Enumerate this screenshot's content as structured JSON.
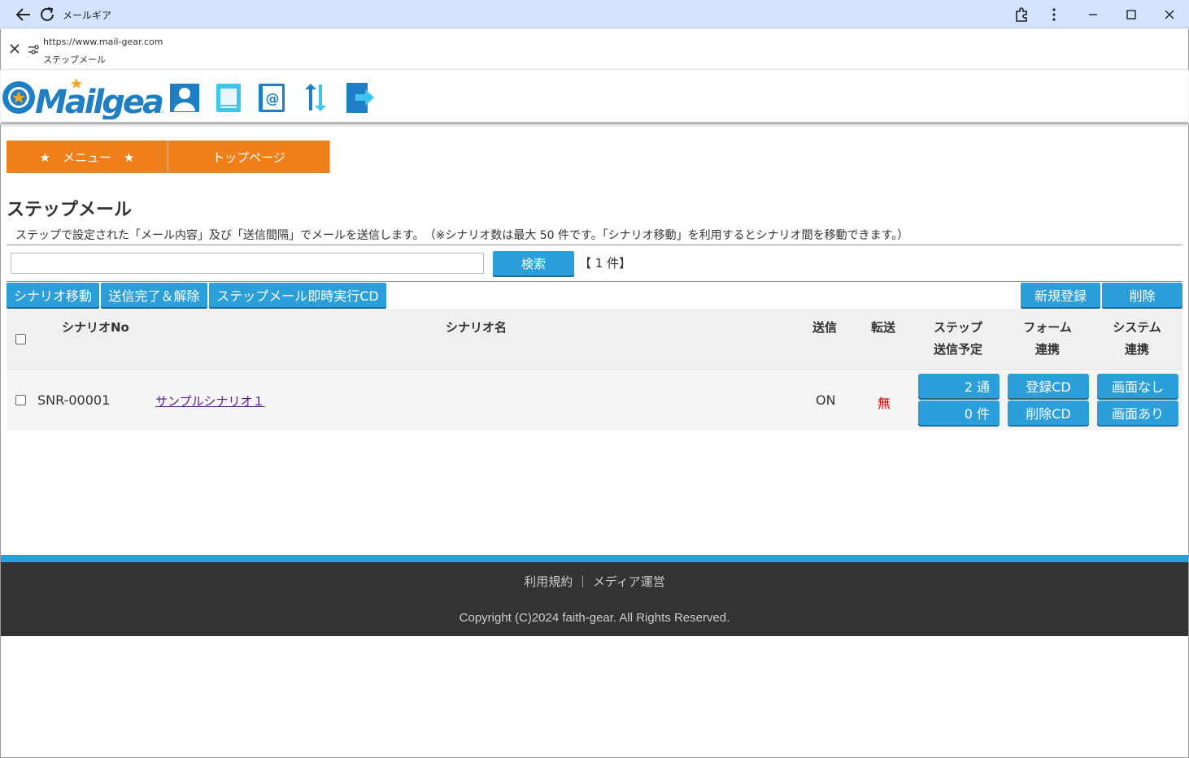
{
  "browser": {
    "window_title": "メールギア",
    "url": "https://www.mail-gear.com",
    "page_name": "ステップメール"
  },
  "header": {
    "logo_text": "Mailgear",
    "icons": [
      "user-icon",
      "document-icon",
      "address-book-icon",
      "sync-icon",
      "logout-icon"
    ]
  },
  "nav": {
    "menu_label": "★　メニュー　★",
    "top_label": "トップページ"
  },
  "page": {
    "title": "ステップメール",
    "description": "ステップで設定された「メール内容」及び「送信間隔」でメールを送信します。　（※シナリオ数は最大 50 件です。「シナリオ移動」を利用するとシナリオ間を移動できます。）"
  },
  "search": {
    "value": "",
    "placeholder": "",
    "button_label": "検索",
    "count_text": "【 1 件】"
  },
  "actions": {
    "move_label": "シナリオ移動",
    "complete_label": "送信完了＆解除",
    "instant_label": "ステップメール即時実行CD",
    "new_label": "新規登録",
    "delete_label": "削除"
  },
  "table": {
    "headers": {
      "no": "シナリオNo",
      "name": "シナリオ名",
      "send": "送信",
      "forward": "転送",
      "step_l1": "ステップ",
      "step_l2": "送信予定",
      "form_l1": "フォーム",
      "form_l2": "連携",
      "system_l1": "システム",
      "system_l2": "連携"
    },
    "rows": [
      {
        "no": "SNR-00001",
        "name": "サンプルシナリオ１",
        "send": "ON",
        "forward": "無",
        "steps": "2 通",
        "scheduled": "0 件",
        "form_register": "登録CD",
        "form_delete": "削除CD",
        "system_none": "画面なし",
        "system_with": "画面あり"
      }
    ]
  },
  "footer": {
    "terms": "利用規約",
    "separator": "｜",
    "media": "メディア運営",
    "copyright": "Copyright (C)2024 faith-gear. All Rights Reserved."
  },
  "colors": {
    "accent_blue": "#2c9fdb",
    "nav_orange": "#ef7f1a",
    "footer_bg": "#333333",
    "forward_red": "#e00000"
  }
}
